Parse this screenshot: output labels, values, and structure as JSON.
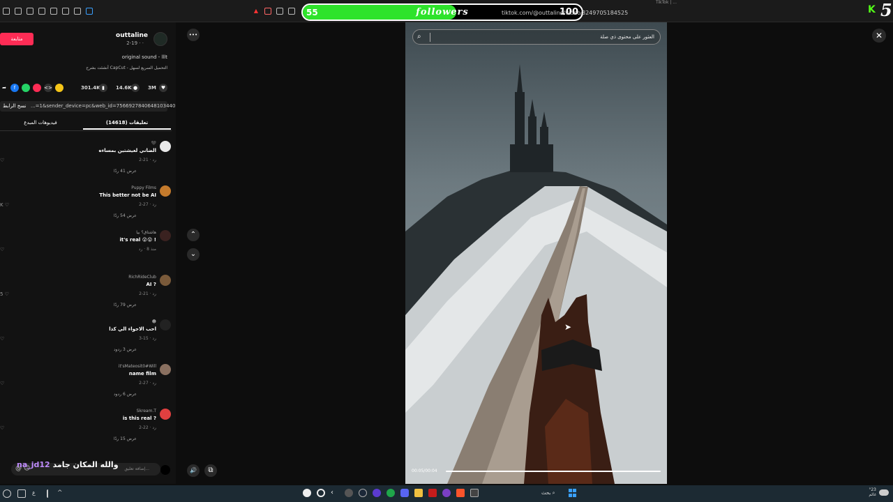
{
  "browser": {
    "url": "tiktok.com/@outtaline/video/",
    "url_tail": "8249705184525",
    "tab_text": "TikTok | ..."
  },
  "overlay": {
    "label": "followers",
    "current": "55",
    "goal": "100",
    "progress_fraction": 0.55,
    "fill_color": "#2ee32b"
  },
  "stream": {
    "corner_number": "5",
    "kick_logo": "K"
  },
  "profile": {
    "follow_label": "متابعة",
    "username": "outtaline",
    "date": "2-19 · ·",
    "sound": "original sound - lllt",
    "capcut": "أنشئت بشرح CapCut - التحميل السريع لسهل"
  },
  "stats": {
    "likes": "3M",
    "comments": "14.6K",
    "saves": "301.4K"
  },
  "link": {
    "copy_label": "نسخ الرابط",
    "text": "...=1&sender_device=pc&web_id=7566927840648103440"
  },
  "tabs": {
    "comments": "تعليقات (14618)",
    "creator": "فيديوهات المبدع"
  },
  "comments": [
    {
      "name": "🖤",
      "text": "الضاني لعيشتين بمساءه",
      "meta": "2-21 · رد",
      "more": "عرض 41 ردًا",
      "heart": "♡",
      "avatar_color": "#e8e8e8"
    },
    {
      "name": "Puppy Films",
      "text": "This better not be AI",
      "meta": "2-27 · رد",
      "more": "عرض 54 ردًا",
      "heart": "K ♡",
      "avatar_color": "#c47a2c"
    },
    {
      "name": "هاشتاق؟ بيا",
      "text": "it's real 😮😮 !",
      "meta": "منذ 8 · رد",
      "more": "",
      "heart": "♡",
      "avatar_color": "#3a2220"
    },
    {
      "name": "RichRideClub",
      "text": "AI ?",
      "meta": "2-21 · رد",
      "more": "عرض 79 ردًا",
      "heart": "5 ♡",
      "avatar_color": "#7a5a3a"
    },
    {
      "name": "☻",
      "text": "احب الاجواء الي كذا",
      "meta": "3-15 · رد",
      "more": "عرض 3 ردود",
      "heart": "♡",
      "avatar_color": "#222222"
    },
    {
      "name": "it'sMateosit0#Will",
      "text": "name film",
      "meta": "2-27 · رد",
      "more": "عرض 6 ردود",
      "heart": "♡",
      "avatar_color": "#8a7060"
    },
    {
      "name": "Skream.T",
      "text": "is this real ?",
      "meta": "2-22 · رد",
      "more": "عرض 15 ردًا",
      "heart": "♡",
      "avatar_color": "#e04040"
    }
  ],
  "add_comment": {
    "placeholder": "إضافة تعليق...",
    "at": "@ ☺"
  },
  "chat": {
    "user": "na_jd12",
    "message": "والله المكان جامد"
  },
  "video": {
    "search_placeholder": "العثور على محتوى ذي صلة",
    "time": "00:05/00:04",
    "progress_fraction": 1.0
  },
  "controls": {
    "more": "•••",
    "up": "⌃",
    "down": "⌄",
    "close": "✕",
    "volume": "🔊"
  },
  "taskbar": {
    "search": "بحث",
    "weather": "°23 غائم",
    "lang": "ع"
  }
}
